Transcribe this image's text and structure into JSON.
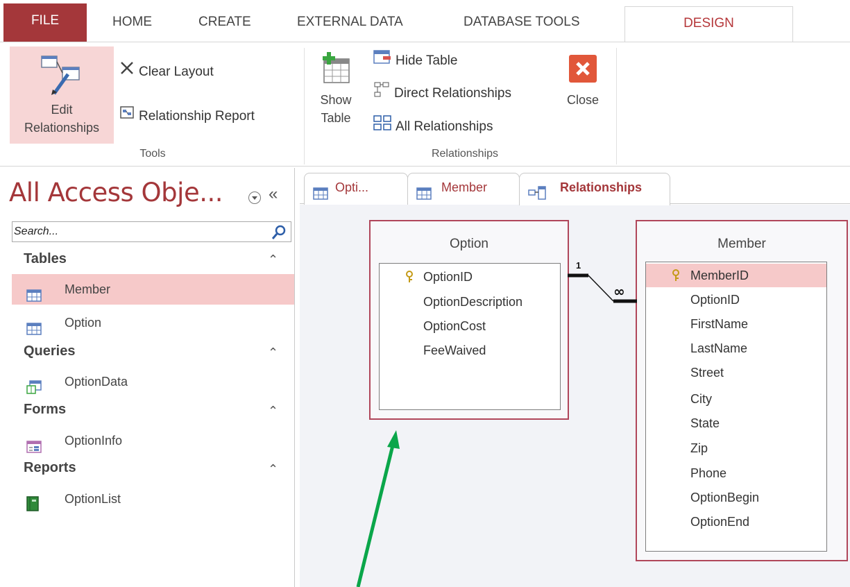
{
  "ribbon_tabs": {
    "file": "FILE",
    "home": "HOME",
    "create": "CREATE",
    "external": "EXTERNAL DATA",
    "dbtools": "DATABASE TOOLS",
    "design": "DESIGN"
  },
  "ribbon": {
    "tools": {
      "edit_relationships_line1": "Edit",
      "edit_relationships_line2": "Relationships",
      "clear_layout": "Clear Layout",
      "relationship_report": "Relationship Report",
      "group_label": "Tools"
    },
    "relationships": {
      "show_table_line1": "Show",
      "show_table_line2": "Table",
      "hide_table": "Hide Table",
      "direct_relationships": "Direct Relationships",
      "all_relationships": "All Relationships",
      "close": "Close",
      "group_label": "Relationships"
    }
  },
  "nav": {
    "title": "All Access Obje...",
    "search_placeholder": "Search...",
    "sections": [
      {
        "header": "Tables",
        "items": [
          "Member",
          "Option"
        ]
      },
      {
        "header": "Queries",
        "items": [
          "OptionData"
        ]
      },
      {
        "header": "Forms",
        "items": [
          "OptionInfo"
        ]
      },
      {
        "header": "Reports",
        "items": [
          "OptionList"
        ]
      }
    ]
  },
  "doc_tabs": [
    {
      "label": "Opti..."
    },
    {
      "label": "Member"
    },
    {
      "label": "Relationships"
    }
  ],
  "relationship_view": {
    "option_table": {
      "title": "Option",
      "fields": [
        "OptionID",
        "OptionDescription",
        "OptionCost",
        "FeeWaived"
      ],
      "key_field": "OptionID"
    },
    "member_table": {
      "title": "Member",
      "fields": [
        "MemberID",
        "OptionID",
        "FirstName",
        "LastName",
        "Street",
        "City",
        "State",
        "Zip",
        "Phone",
        "OptionBegin",
        "OptionEnd"
      ],
      "key_field": "MemberID"
    },
    "join": {
      "one_side": "1",
      "many_side": "∞"
    }
  },
  "colors": {
    "accent": "#a4373a",
    "selection": "#f6c9c9",
    "canvas": "#f2f3f7",
    "annotation_arrow": "#0aa64a"
  }
}
